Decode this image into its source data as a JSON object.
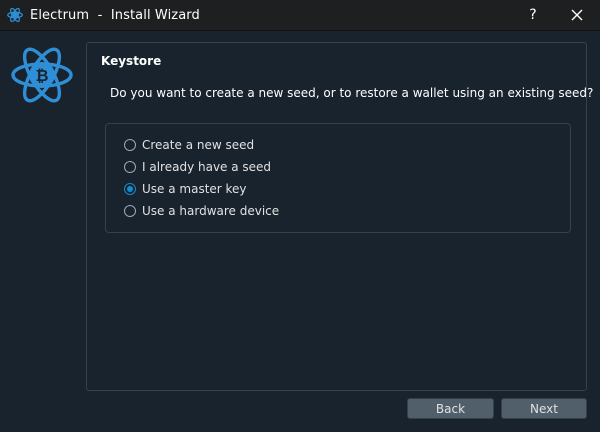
{
  "window": {
    "title": "Electrum  -  Install Wizard",
    "help_label": "?",
    "close_icon": "close-icon",
    "app_icon": "electrum-atom-icon"
  },
  "logo": {
    "icon": "electrum-bitcoin-atom-logo"
  },
  "panel": {
    "title": "Keystore",
    "question": "Do you want to create a new seed, or to restore a wallet using an existing seed?",
    "options": [
      {
        "label": "Create a new seed",
        "checked": false
      },
      {
        "label": "I already have a seed",
        "checked": false
      },
      {
        "label": "Use a master key",
        "checked": true
      },
      {
        "label": "Use a hardware device",
        "checked": false
      }
    ]
  },
  "buttons": {
    "back_label": "Back",
    "next_label": "Next"
  },
  "colors": {
    "background": "#19232d",
    "titlebar": "#1d1f21",
    "accent": "#148cd2",
    "logo_blue": "#2f8fd6",
    "button": "#505f69",
    "border": "#32414b"
  }
}
